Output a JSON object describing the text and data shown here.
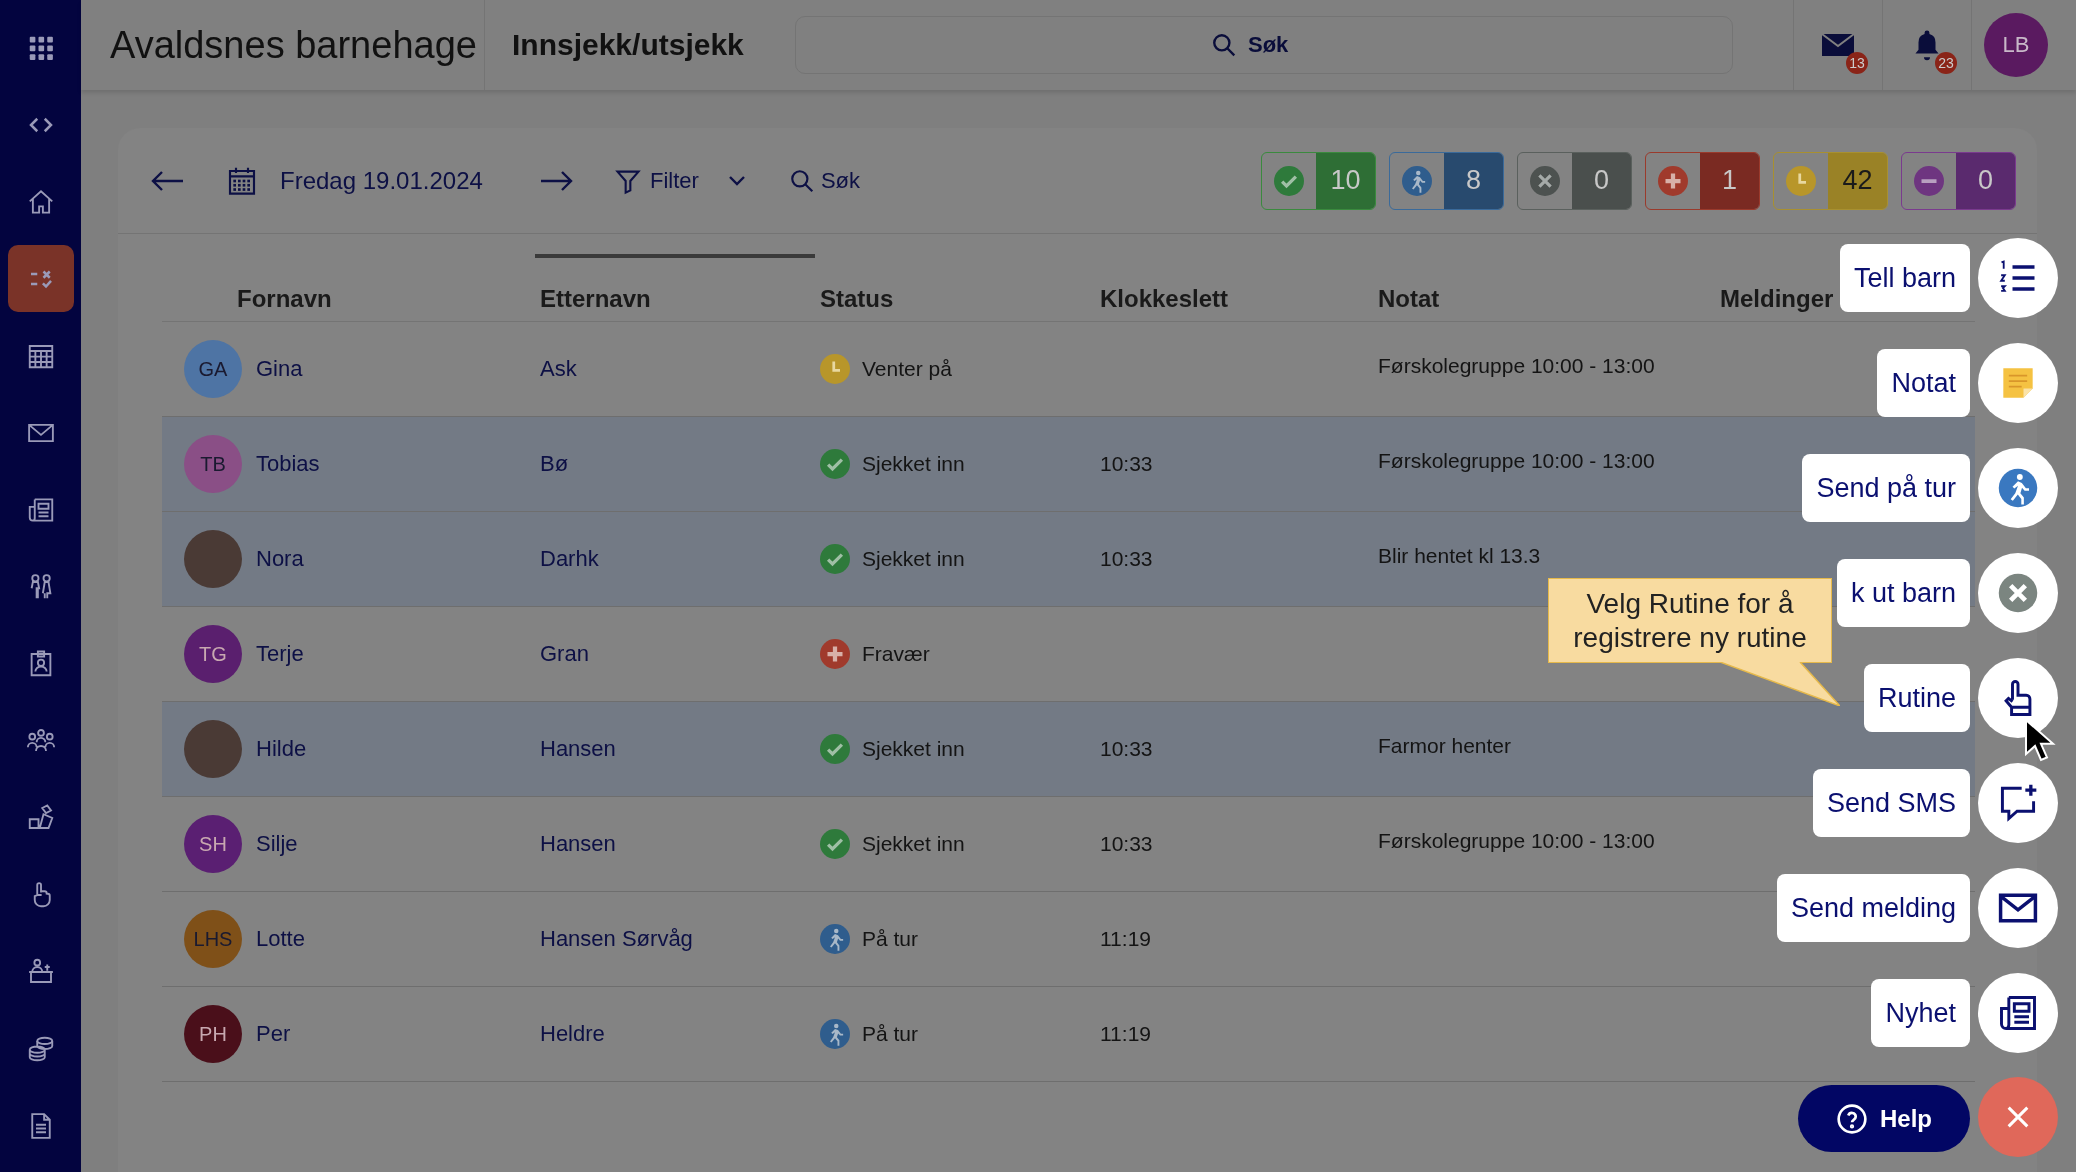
{
  "app": {
    "title": "Avaldsnes barnehage",
    "page": "Innsjekk/utsjekk"
  },
  "top_bar": {
    "search": {
      "placeholder": "Søk"
    },
    "mail_badge": "13",
    "notification_badge": "23",
    "user_initials": "LB"
  },
  "sidebar": {
    "items": [
      {
        "kind": "apps",
        "selected": false
      },
      {
        "kind": "collapse",
        "selected": false
      },
      {
        "kind": "home",
        "selected": false
      },
      {
        "kind": "checkin",
        "selected": true
      },
      {
        "kind": "calendar",
        "selected": false
      },
      {
        "kind": "mail",
        "selected": false
      },
      {
        "kind": "news",
        "selected": false
      },
      {
        "kind": "children",
        "selected": false
      },
      {
        "kind": "badge",
        "selected": false
      },
      {
        "kind": "group",
        "selected": false
      },
      {
        "kind": "toys",
        "selected": false
      },
      {
        "kind": "hand",
        "selected": false
      },
      {
        "kind": "desk",
        "selected": false
      },
      {
        "kind": "coins",
        "selected": false
      },
      {
        "kind": "document",
        "selected": false
      }
    ]
  },
  "toolbar": {
    "date": "Fredag 19.01.2024",
    "filter": "Filter",
    "search": {
      "placeholder": "Søk"
    }
  },
  "counters": [
    {
      "kind": "checked_in",
      "count": "10"
    },
    {
      "kind": "trip",
      "count": "8"
    },
    {
      "kind": "checked_out",
      "count": "0"
    },
    {
      "kind": "absent",
      "count": "1"
    },
    {
      "kind": "waiting",
      "count": "42"
    },
    {
      "kind": "other",
      "count": "0"
    }
  ],
  "table": {
    "columns": [
      {
        "label": "Fornavn",
        "sorted": false
      },
      {
        "label": "Etternavn",
        "sorted": true
      },
      {
        "label": "Status",
        "sorted": false
      },
      {
        "label": "Klokkeslett",
        "sorted": false
      },
      {
        "label": "Notat",
        "sorted": false
      },
      {
        "label": "Meldinger",
        "sorted": false
      }
    ],
    "rows": [
      {
        "first_name": "Gina",
        "last_name": "Ask",
        "avatar": {
          "kind": "initials",
          "initials": "GA",
          "color": "#4e74a4"
        },
        "status": {
          "kind": "waiting",
          "label": "Venter på"
        },
        "note": "Førskolegruppe 10:00 - 13:00",
        "selected": false
      },
      {
        "first_name": "Tobias",
        "last_name": "Bø",
        "avatar": {
          "kind": "initials",
          "initials": "TB",
          "color": "#8a4f86"
        },
        "status": {
          "kind": "checked_in",
          "label": "Sjekket inn"
        },
        "time": "10:33",
        "note": "Førskolegruppe 10:00 - 13:00",
        "selected": true
      },
      {
        "first_name": "Nora",
        "last_name": "Darhk",
        "avatar": {
          "kind": "photo"
        },
        "status": {
          "kind": "checked_in",
          "label": "Sjekket inn"
        },
        "time": "10:33",
        "note": "Blir hentet kl 13.3",
        "selected": true
      },
      {
        "first_name": "Terje",
        "last_name": "Gran",
        "avatar": {
          "kind": "initials",
          "initials": "TG",
          "color": "#5a1f6e"
        },
        "status": {
          "kind": "absent",
          "label": "Fravær"
        },
        "selected": false
      },
      {
        "first_name": "Hilde",
        "last_name": "Hansen",
        "avatar": {
          "kind": "photo"
        },
        "status": {
          "kind": "checked_in",
          "label": "Sjekket inn"
        },
        "time": "10:33",
        "note": "Farmor henter",
        "selected": true
      },
      {
        "first_name": "Silje",
        "last_name": "Hansen",
        "avatar": {
          "kind": "initials",
          "initials": "SH",
          "color": "#5a1f72"
        },
        "status": {
          "kind": "checked_in",
          "label": "Sjekket inn"
        },
        "time": "10:33",
        "note": "Førskolegruppe 10:00 - 13:00",
        "selected": false
      },
      {
        "first_name": "Lotte",
        "last_name": "Hansen Sørvåg",
        "avatar": {
          "kind": "initials",
          "initials": "LHS",
          "color": "#7f5018"
        },
        "status": {
          "kind": "trip",
          "label": "På tur"
        },
        "time": "11:19",
        "selected": false
      },
      {
        "first_name": "Per",
        "last_name": "Heldre",
        "avatar": {
          "kind": "initials",
          "initials": "PH",
          "color": "#4a0f1a"
        },
        "status": {
          "kind": "trip",
          "label": "På tur"
        },
        "time": "11:19",
        "selected": false
      }
    ]
  },
  "actions": [
    {
      "kind": "count",
      "label": "Tell barn"
    },
    {
      "kind": "note",
      "label": "Notat"
    },
    {
      "kind": "trip",
      "label": "Send på tur"
    },
    {
      "kind": "check_out",
      "label": "k ut barn"
    },
    {
      "kind": "routine",
      "label": "Rutine"
    },
    {
      "kind": "sms",
      "label": "Send SMS"
    },
    {
      "kind": "message",
      "label": "Send melding"
    },
    {
      "kind": "news",
      "label": "Nyhet"
    }
  ],
  "tooltip": "Velg Rutine for å registrere ny rutine",
  "help_button": "Help"
}
